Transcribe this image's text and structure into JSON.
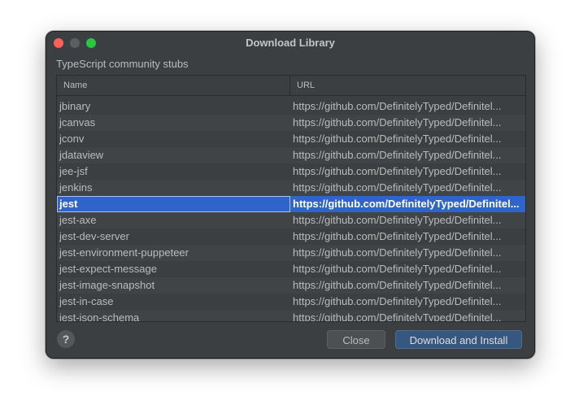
{
  "window": {
    "title": "Download Library",
    "subtitle": "TypeScript community stubs"
  },
  "table": {
    "columns": [
      "Name",
      "URL"
    ],
    "rows": [
      {
        "name": "jbinary",
        "url": "https://github.com/DefinitelyTyped/Definitel..."
      },
      {
        "name": "jcanvas",
        "url": "https://github.com/DefinitelyTyped/Definitel..."
      },
      {
        "name": "jconv",
        "url": "https://github.com/DefinitelyTyped/Definitel..."
      },
      {
        "name": "jdataview",
        "url": "https://github.com/DefinitelyTyped/Definitel..."
      },
      {
        "name": "jee-jsf",
        "url": "https://github.com/DefinitelyTyped/Definitel..."
      },
      {
        "name": "jenkins",
        "url": "https://github.com/DefinitelyTyped/Definitel..."
      },
      {
        "name": "jest",
        "url": "https://github.com/DefinitelyTyped/Definitel...",
        "selected": true
      },
      {
        "name": "jest-axe",
        "url": "https://github.com/DefinitelyTyped/Definitel..."
      },
      {
        "name": "jest-dev-server",
        "url": "https://github.com/DefinitelyTyped/Definitel..."
      },
      {
        "name": "jest-environment-puppeteer",
        "url": "https://github.com/DefinitelyTyped/Definitel..."
      },
      {
        "name": "jest-expect-message",
        "url": "https://github.com/DefinitelyTyped/Definitel..."
      },
      {
        "name": "jest-image-snapshot",
        "url": "https://github.com/DefinitelyTyped/Definitel..."
      },
      {
        "name": "jest-in-case",
        "url": "https://github.com/DefinitelyTyped/Definitel..."
      },
      {
        "name": "jest-json-schema",
        "url": "https://github.com/DefinitelyTyped/Definitel..."
      }
    ]
  },
  "footer": {
    "help_label": "?",
    "close_label": "Close",
    "install_label": "Download and Install"
  },
  "colors": {
    "selection": "#2f65ca",
    "primary_button": "#365880",
    "background": "#3c3f41"
  },
  "icons": {
    "close": "close-window-icon",
    "minimize": "minimize-window-icon",
    "maximize": "zoom-window-icon",
    "help": "help-icon"
  }
}
